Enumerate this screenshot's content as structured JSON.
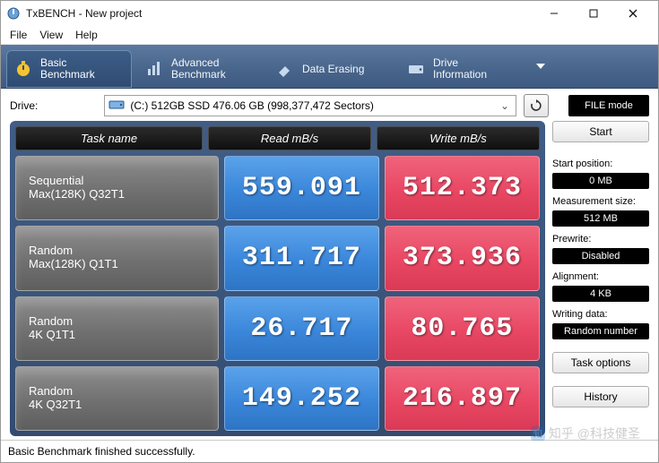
{
  "window": {
    "title": "TxBENCH - New project"
  },
  "menu": {
    "file": "File",
    "view": "View",
    "help": "Help"
  },
  "tabs": {
    "basic1": "Basic",
    "basic2": "Benchmark",
    "adv1": "Advanced",
    "adv2": "Benchmark",
    "erase": "Data Erasing",
    "drive1": "Drive",
    "drive2": "Information"
  },
  "drive": {
    "label": "Drive:",
    "text": "(C:) 512GB SSD  476.06 GB (998,377,472 Sectors)",
    "filemode": "FILE mode"
  },
  "headers": {
    "task": "Task name",
    "read": "Read  mB/s",
    "write": "Write  mB/s"
  },
  "rows": [
    {
      "t1": "Sequential",
      "t2": "Max(128K) Q32T1",
      "read": "559.091",
      "write": "512.373"
    },
    {
      "t1": "Random",
      "t2": "Max(128K) Q1T1",
      "read": "311.717",
      "write": "373.936"
    },
    {
      "t1": "Random",
      "t2": "4K Q1T1",
      "read": "26.717",
      "write": "80.765"
    },
    {
      "t1": "Random",
      "t2": "4K Q32T1",
      "read": "149.252",
      "write": "216.897"
    }
  ],
  "side": {
    "start": "Start",
    "start_pos_lbl": "Start position:",
    "start_pos": "0 MB",
    "meas_lbl": "Measurement size:",
    "meas": "512 MB",
    "prewrite_lbl": "Prewrite:",
    "prewrite": "Disabled",
    "align_lbl": "Alignment:",
    "align": "4 KB",
    "wdata_lbl": "Writing data:",
    "wdata": "Random number",
    "taskopt": "Task options",
    "history": "History"
  },
  "status": "Basic Benchmark finished successfully.",
  "watermark": "知乎 @科技健圣"
}
